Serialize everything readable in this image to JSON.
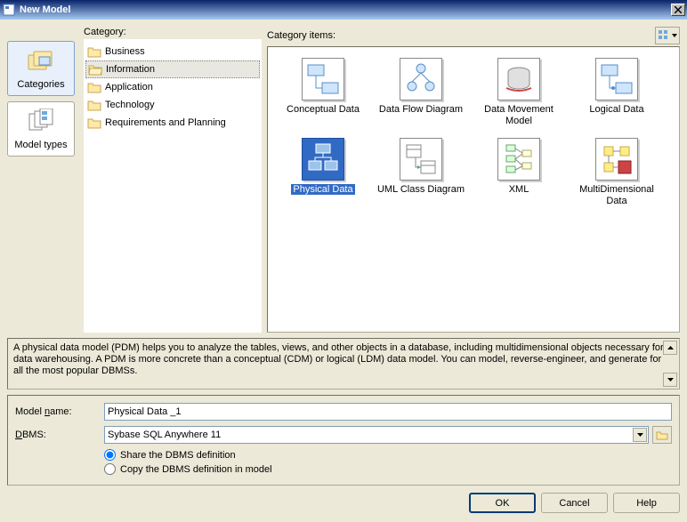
{
  "window": {
    "title": "New Model"
  },
  "left_nav": {
    "categories_label": "Categories",
    "model_types_label": "Model types"
  },
  "category_label": "Category:",
  "categories": [
    {
      "label": "Business",
      "selected": false
    },
    {
      "label": "Information",
      "selected": true
    },
    {
      "label": "Application",
      "selected": false
    },
    {
      "label": "Technology",
      "selected": false
    },
    {
      "label": "Requirements and Planning",
      "selected": false
    }
  ],
  "items_label": "Category items:",
  "items": [
    {
      "label": "Conceptual Data",
      "selected": false
    },
    {
      "label": "Data Flow Diagram",
      "selected": false
    },
    {
      "label": "Data Movement Model",
      "selected": false
    },
    {
      "label": "Logical Data",
      "selected": false
    },
    {
      "label": "Physical Data",
      "selected": true
    },
    {
      "label": "UML Class Diagram",
      "selected": false
    },
    {
      "label": "XML",
      "selected": false
    },
    {
      "label": "MultiDimensional Data",
      "selected": false
    }
  ],
  "description": "A physical data model (PDM) helps you to analyze the tables, views, and other objects in a database, including multidimensional objects necessary for data warehousing. A PDM is more concrete than a conceptual (CDM) or logical (LDM) data model. You can model, reverse-engineer, and generate for all the most popular DBMSs.",
  "form": {
    "model_name_label": "Model name:",
    "model_name_value": "Physical Data _1",
    "dbms_label": "DBMS:",
    "dbms_value": "Sybase SQL Anywhere 11",
    "radio_share": "Share the DBMS definition",
    "radio_copy": "Copy the DBMS definition in model"
  },
  "buttons": {
    "ok": "OK",
    "cancel": "Cancel",
    "help": "Help"
  }
}
